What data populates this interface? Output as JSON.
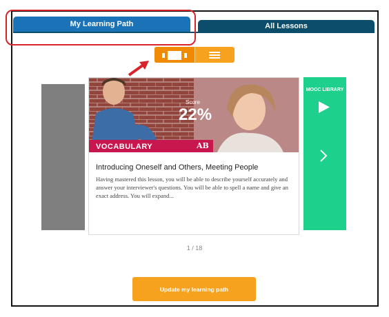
{
  "tabs": {
    "active_label": "My Learning Path",
    "inactive_label": "All Lessons"
  },
  "view_toggle": {
    "selected": "carousel",
    "icons": [
      "carousel-view-icon",
      "list-view-icon"
    ]
  },
  "lesson": {
    "score_label": "Score",
    "score_value": "22%",
    "category": "VOCABULARY",
    "brand": "AB",
    "title": "Introducing Oneself and Others, Meeting People",
    "description": "Having mastered this lesson, you will be able to describe yourself accurately and answer your interviewer's questions. You will be able to spell a name and give an exact address. You will expand..."
  },
  "side_panel": {
    "mooc_label": "MOOC LIBRARY"
  },
  "pagination": "1 / 18",
  "update_button_label": "Update my learning path",
  "colors": {
    "tab_active": "#1a73b7",
    "tab_inactive": "#0b4d6b",
    "orange": "#f6a21e",
    "category": "#c8174f",
    "green": "#1dd18c",
    "highlight": "#d8232a"
  }
}
